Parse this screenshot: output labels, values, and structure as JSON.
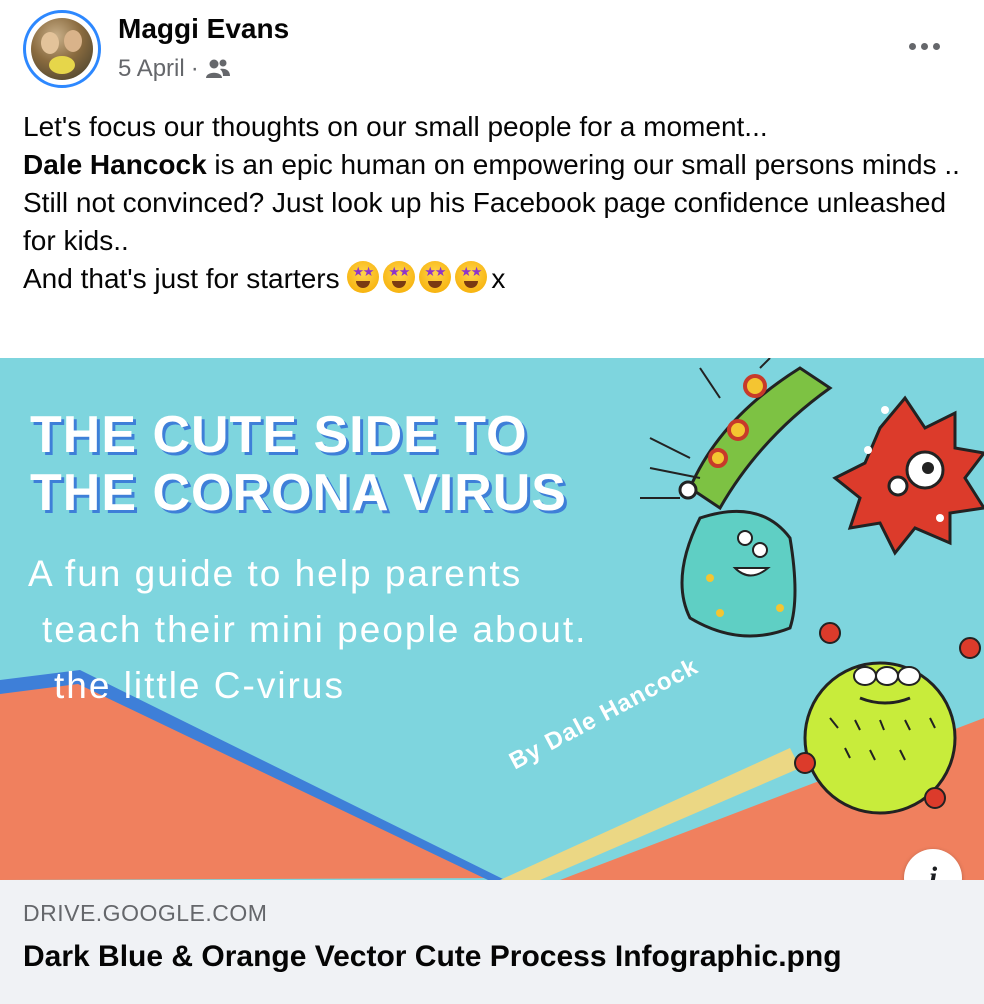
{
  "post": {
    "author": "Maggi Evans",
    "date": "5 April",
    "separator": "·",
    "audience_icon": "friends-icon",
    "text": {
      "line1": "Let's focus our thoughts on our small people for a moment...",
      "mention": "Dale Hancock",
      "line2_rest": " is an epic human on empowering our small persons minds ..",
      "line3": "Still not convinced? Just look up his Facebook page confidence unleashed for kids..",
      "line4": "And that's just for starters ",
      "line4_end": "x",
      "emoji_name": "star-struck-emoji"
    }
  },
  "link": {
    "image": {
      "title_line1": "THE CUTE SIDE TO",
      "title_line2": "THE CORONA VIRUS",
      "sub_line1": "A fun guide to help parents",
      "sub_line2": "teach their mini people about.",
      "sub_line3": "the little C-virus",
      "author": "By Dale Hancock"
    },
    "info_label": "i",
    "domain": "DRIVE.GOOGLE.COM",
    "title": "Dark Blue & Orange Vector Cute Process Infographic.png"
  },
  "colors": {
    "accent": "#2d88ff",
    "image_bg": "#7ed5de",
    "image_orange": "#f0805e",
    "meta_bg": "#f0f2f5"
  }
}
